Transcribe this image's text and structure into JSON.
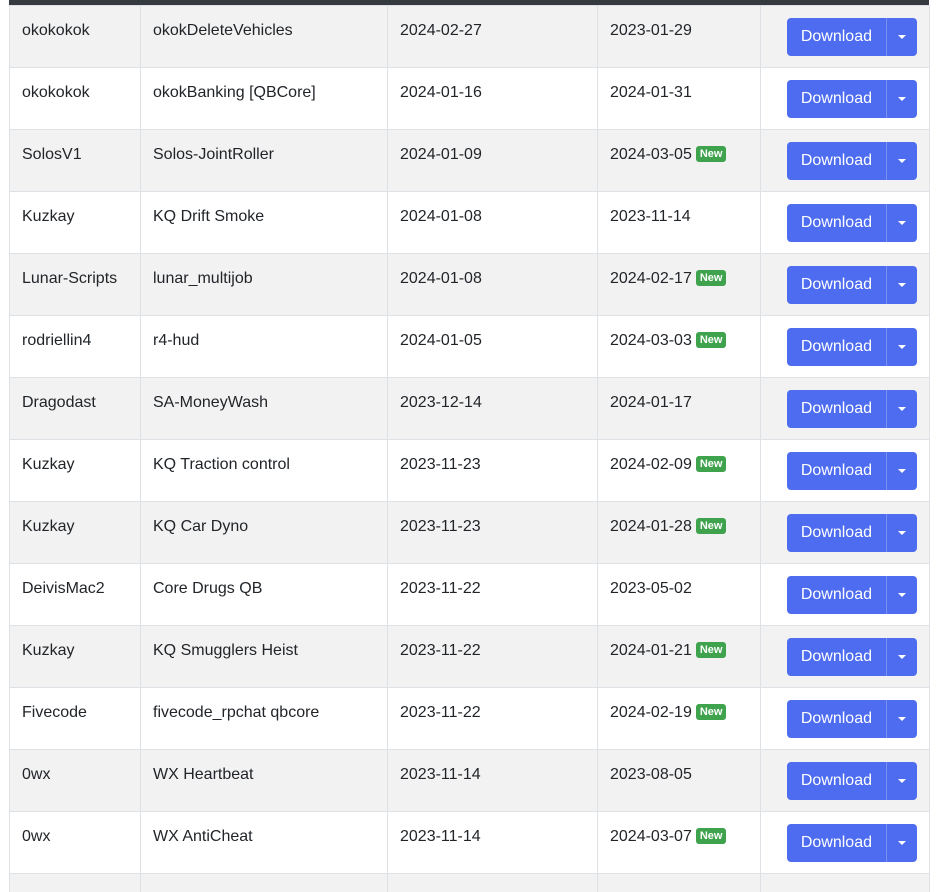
{
  "table": {
    "download_label": "Download",
    "new_badge_label": "New",
    "rows": [
      {
        "author": "okokokok",
        "name": "okokDeleteVehicles",
        "released": "2024-02-27",
        "updated": "2023-01-29",
        "is_new": false
      },
      {
        "author": "okokokok",
        "name": "okokBanking [QBCore]",
        "released": "2024-01-16",
        "updated": "2024-01-31",
        "is_new": false
      },
      {
        "author": "SolosV1",
        "name": "Solos-JointRoller",
        "released": "2024-01-09",
        "updated": "2024-03-05",
        "is_new": true
      },
      {
        "author": "Kuzkay",
        "name": "KQ Drift Smoke",
        "released": "2024-01-08",
        "updated": "2023-11-14",
        "is_new": false
      },
      {
        "author": "Lunar-Scripts",
        "name": "lunar_multijob",
        "released": "2024-01-08",
        "updated": "2024-02-17",
        "is_new": true
      },
      {
        "author": "rodriellin4",
        "name": "r4-hud",
        "released": "2024-01-05",
        "updated": "2024-03-03",
        "is_new": true
      },
      {
        "author": "Dragodast",
        "name": "SA-MoneyWash",
        "released": "2023-12-14",
        "updated": "2024-01-17",
        "is_new": false
      },
      {
        "author": "Kuzkay",
        "name": "KQ Traction control",
        "released": "2023-11-23",
        "updated": "2024-02-09",
        "is_new": true
      },
      {
        "author": "Kuzkay",
        "name": "KQ Car Dyno",
        "released": "2023-11-23",
        "updated": "2024-01-28",
        "is_new": true
      },
      {
        "author": "DeivisMac2",
        "name": "Core Drugs QB",
        "released": "2023-11-22",
        "updated": "2023-05-02",
        "is_new": false
      },
      {
        "author": "Kuzkay",
        "name": "KQ Smugglers Heist",
        "released": "2023-11-22",
        "updated": "2024-01-21",
        "is_new": true
      },
      {
        "author": "Fivecode",
        "name": "fivecode_rpchat qbcore",
        "released": "2023-11-22",
        "updated": "2024-02-19",
        "is_new": true
      },
      {
        "author": "0wx",
        "name": "WX Heartbeat",
        "released": "2023-11-14",
        "updated": "2023-08-05",
        "is_new": false
      },
      {
        "author": "0wx",
        "name": "WX AntiCheat",
        "released": "2023-11-14",
        "updated": "2024-03-07",
        "is_new": true
      },
      {
        "author": "",
        "name": "",
        "released": "",
        "updated": "",
        "is_new": false
      }
    ]
  },
  "colors": {
    "button": "#4d6cf0",
    "badge_new": "#3fa34d",
    "header_bar": "#343a40",
    "row_stripe": "#f2f2f2"
  },
  "icons": {
    "dropdown_toggle": "caret-down-icon"
  }
}
